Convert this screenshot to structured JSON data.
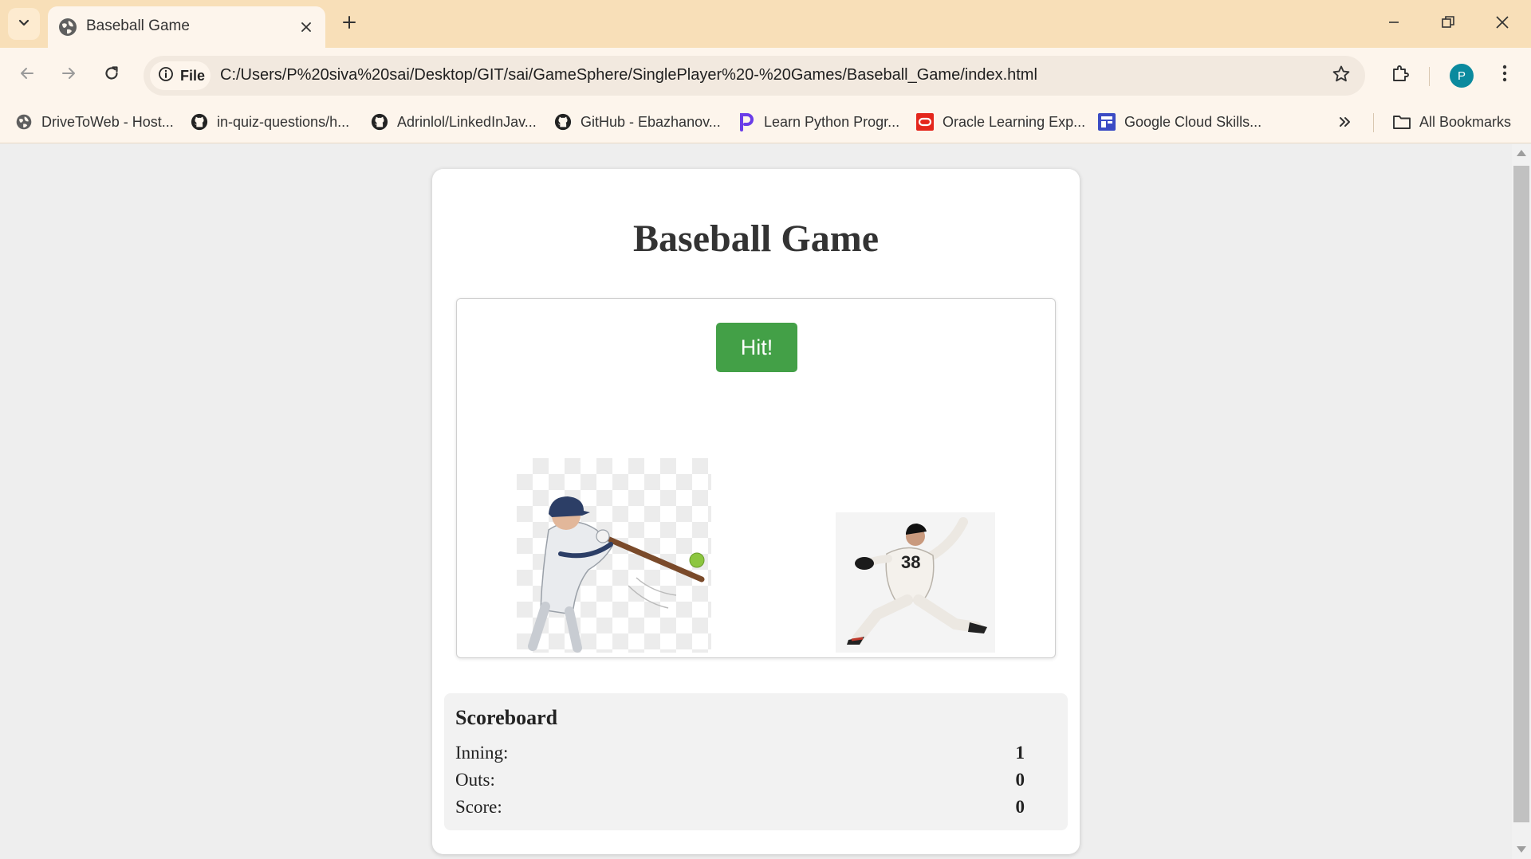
{
  "browser": {
    "tab": {
      "title": "Baseball Game",
      "icon": "globe-icon"
    },
    "url": {
      "chip_label": "File",
      "text": "C:/Users/P%20siva%20sai/Desktop/GIT/sai/GameSphere/SinglePlayer%20-%20Games/Baseball_Game/index.html"
    },
    "profile_initial": "P",
    "profile_color": "#0b8a9e",
    "bookmarks": [
      {
        "label": "DriveToWeb - Host...",
        "icon": "globe-icon"
      },
      {
        "label": "in-quiz-questions/h...",
        "icon": "github-icon"
      },
      {
        "label": "Adrinlol/LinkedInJav...",
        "icon": "github-icon"
      },
      {
        "label": "GitHub - Ebazhanov...",
        "icon": "github-icon"
      },
      {
        "label": "Learn Python Progr...",
        "icon": "programiz-icon"
      },
      {
        "label": "Oracle Learning Exp...",
        "icon": "oracle-icon"
      },
      {
        "label": "Google Cloud Skills...",
        "icon": "google-cloud-skills-icon"
      }
    ],
    "all_bookmarks_label": "All Bookmarks"
  },
  "game": {
    "title": "Baseball Game",
    "hit_button_label": "Hit!",
    "hit_button_color": "#43a047"
  },
  "scoreboard": {
    "title": "Scoreboard",
    "rows": [
      {
        "label": "Inning:",
        "value": "1"
      },
      {
        "label": "Outs:",
        "value": "0"
      },
      {
        "label": "Score:",
        "value": "0"
      }
    ]
  }
}
